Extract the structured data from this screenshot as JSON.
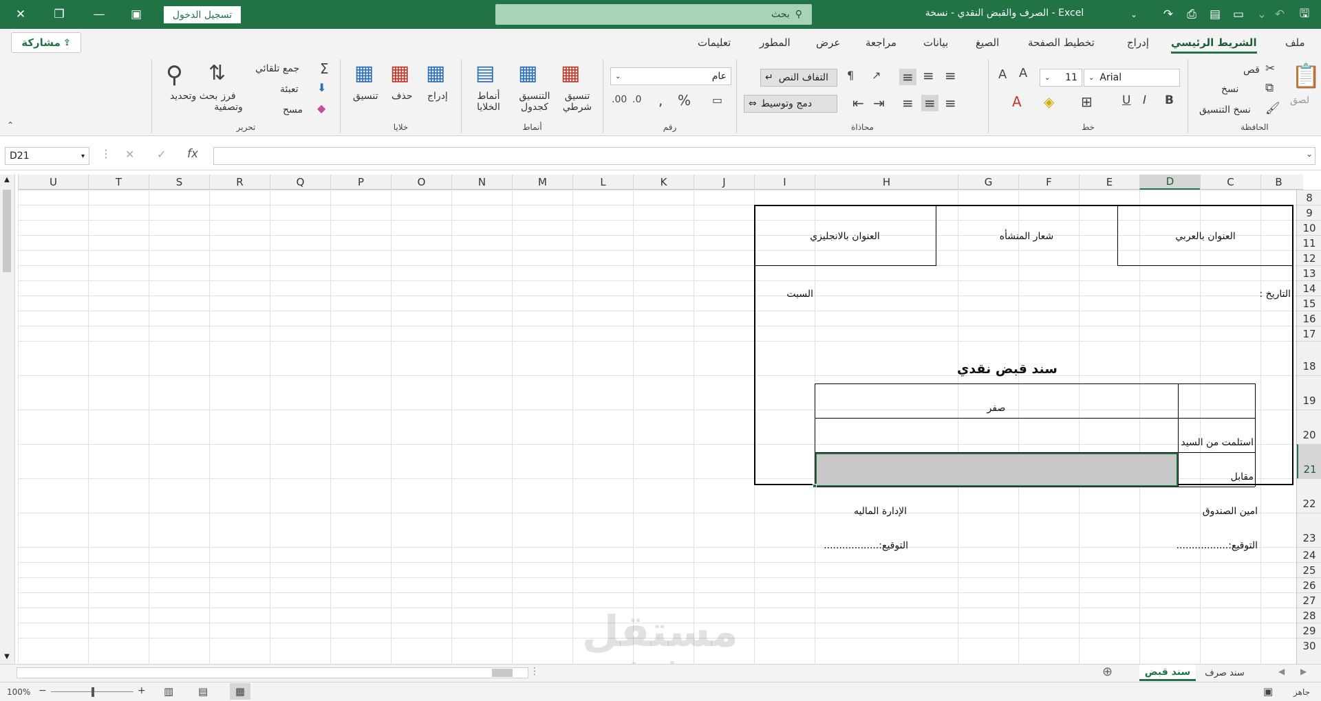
{
  "titlebar": {
    "doc_title": "الصرف والقبض النقدي - نسخة  -  Excel",
    "search_placeholder": "بحث",
    "signin_label": "تسجيل الدخول"
  },
  "menu": {
    "tabs": [
      "ملف",
      "الشريط الرئيسي",
      "إدراج",
      "تخطيط الصفحة",
      "الصيغ",
      "بيانات",
      "مراجعة",
      "عرض",
      "المطور",
      "تعليمات"
    ],
    "share_label": "مشاركة"
  },
  "ribbon": {
    "clipboard": {
      "label": "الحافظة",
      "paste": "لصق",
      "cut": "قص",
      "copy": "نسخ",
      "format_painter": "نسخ التنسيق"
    },
    "font": {
      "label": "خط",
      "name": "Arial",
      "size": "11"
    },
    "alignment": {
      "label": "محاذاة",
      "wrap_text": "التفاف النص",
      "merge_center": "دمج وتوسيط"
    },
    "number": {
      "label": "رقم",
      "format": "عام"
    },
    "styles": {
      "label": "أنماط",
      "conditional": "تنسيق شرطي",
      "as_table": "التنسيق كجدول",
      "cell_styles": "أنماط الخلايا"
    },
    "cells": {
      "label": "خلايا",
      "insert": "إدراج",
      "delete": "حذف",
      "format": "تنسيق"
    },
    "editing": {
      "label": "تحرير",
      "autosum": "جمع تلقائي",
      "fill": "تعبئة",
      "clear": "مسح",
      "sort_filter": "فرز وتصفية",
      "find_select": "بحث وتحديد"
    }
  },
  "formula_bar": {
    "name_box": "D21",
    "formula": ""
  },
  "grid": {
    "columns": [
      "B",
      "C",
      "D",
      "E",
      "F",
      "G",
      "H",
      "I",
      "J",
      "K",
      "L",
      "M",
      "N",
      "O",
      "P",
      "Q",
      "R",
      "S",
      "T",
      "U"
    ],
    "rows": [
      "8",
      "9",
      "10",
      "11",
      "12",
      "13",
      "14",
      "15",
      "16",
      "17",
      "18",
      "19",
      "20",
      "21",
      "22",
      "23",
      "24",
      "25",
      "26",
      "27",
      "28",
      "29",
      "30"
    ],
    "selected_column": "D",
    "selected_row": "21"
  },
  "voucher": {
    "arabic_title": "العنوان بالعربي",
    "logo": "شعار المنشأه",
    "english_title": "العنوان بالانجليزي",
    "date_label": "التاريخ :",
    "day": "السبت",
    "heading": "سند قبض نقدي",
    "amount_words": "صفر",
    "received_from": "استلمت من السيد",
    "against": "مقابل",
    "cashier": "امين الصندوق",
    "finance": "الإدارة الماليه",
    "signature_1": "التوقيع:.................",
    "signature_2": "التوقيع:.................."
  },
  "sheets": {
    "tabs": [
      "سند صرف",
      "سند قبض"
    ],
    "active": "سند قبض"
  },
  "status": {
    "ready": "جاهز",
    "zoom": "100%"
  },
  "watermark": {
    "logo": "مستقل",
    "url": "mostaql.com"
  },
  "colors": {
    "accent": "#217346",
    "selection_fill": "#c8c8c8"
  }
}
